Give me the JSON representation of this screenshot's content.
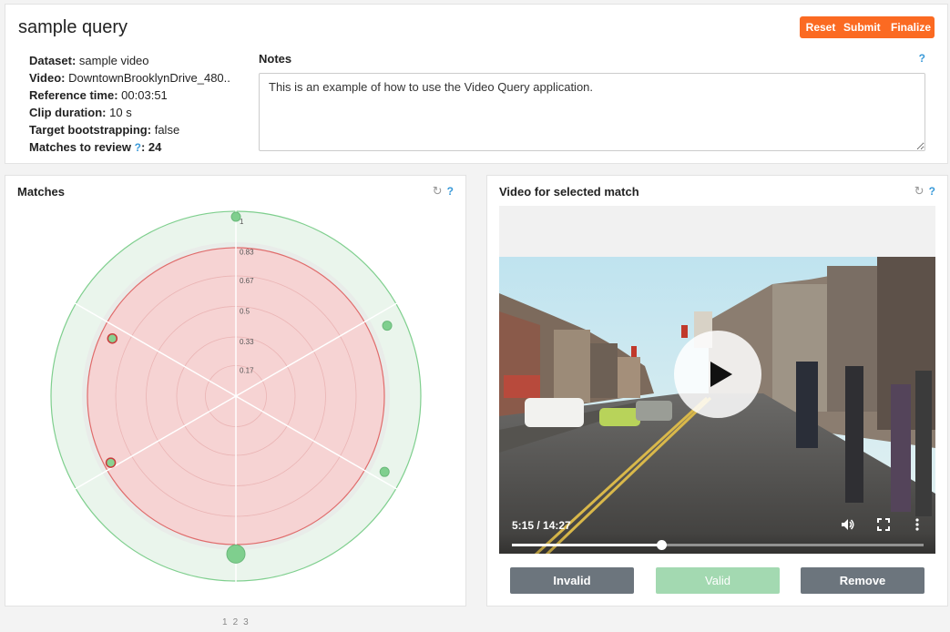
{
  "header": {
    "title": "sample query",
    "buttons": {
      "reset": "Reset",
      "submit": "Submit",
      "finalize": "Finalize"
    }
  },
  "meta": [
    {
      "label": "Dataset:",
      "value": "sample video"
    },
    {
      "label": "Video:",
      "value": "DowntownBrooklynDrive_480.."
    },
    {
      "label": "Reference time:",
      "value": "00:03:51"
    },
    {
      "label": "Clip duration:",
      "value": "10 s"
    },
    {
      "label": "Target bootstrapping:",
      "value": "false"
    }
  ],
  "matches_row": {
    "label": "Matches to review",
    "help": "?",
    "value": ": 24"
  },
  "notes": {
    "label": "Notes",
    "help": "?",
    "value": "This is an example of how to use the Video Query application."
  },
  "matches_panel": {
    "title": "Matches",
    "help": "?",
    "pages": [
      "1",
      "2",
      "3"
    ]
  },
  "chart_data": {
    "type": "scatter",
    "subtype": "polar",
    "radial_ticks": [
      "1",
      "0.83",
      "0.67",
      "0.5",
      "0.33",
      "0.17"
    ],
    "radial_range": [
      0,
      1
    ],
    "threshold": 0.83,
    "sectors": 6,
    "colors": {
      "matched": "#7fcf8e",
      "unmatched": "#e06b6b",
      "outer_ring": "#eaf5ec",
      "inner_disk": "#f6d3d3"
    },
    "points": [
      {
        "angle_deg": 0,
        "r": 1.0,
        "status": "matched",
        "size": "small"
      },
      {
        "angle_deg": 65,
        "r": 0.93,
        "status": "matched",
        "size": "small"
      },
      {
        "angle_deg": 117,
        "r": 0.93,
        "status": "matched",
        "size": "small"
      },
      {
        "angle_deg": 180,
        "r": 0.88,
        "status": "matched",
        "size": "large"
      },
      {
        "angle_deg": 242,
        "r": 0.79,
        "status": "unmatched",
        "size": "small"
      },
      {
        "angle_deg": 295,
        "r": 0.76,
        "status": "unmatched",
        "size": "small"
      }
    ]
  },
  "video_panel": {
    "title": "Video for selected match",
    "help": "?",
    "time": "5:15 / 14:27",
    "progress": 0.3633,
    "buttons": {
      "invalid": "Invalid",
      "valid": "Valid",
      "remove": "Remove"
    }
  },
  "icons": {
    "refresh": "refresh-icon",
    "play": "play-icon",
    "volume": "volume-icon",
    "fullscreen": "fullscreen-icon",
    "more": "more-vertical-icon"
  }
}
